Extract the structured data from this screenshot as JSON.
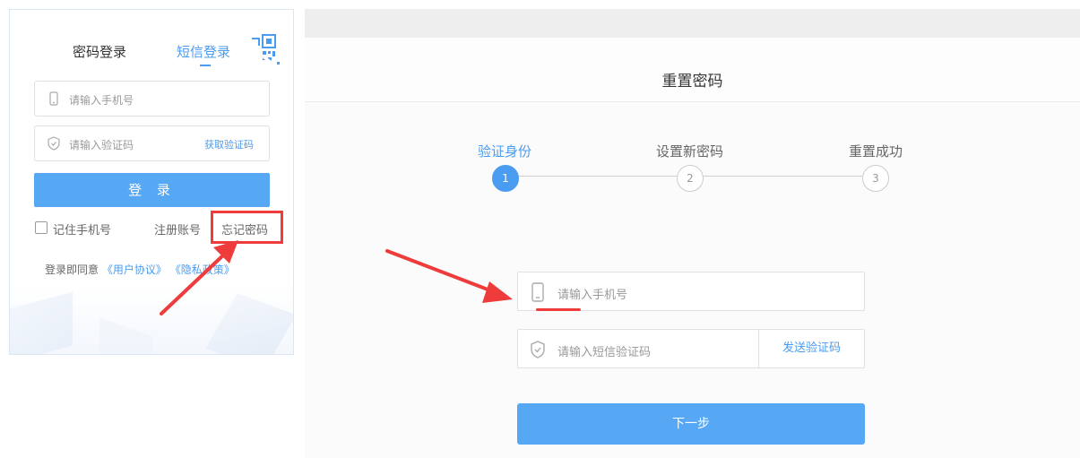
{
  "login": {
    "tabs": {
      "password": "密码登录",
      "sms": "短信登录"
    },
    "phone_placeholder": "请输入手机号",
    "code_placeholder": "请输入验证码",
    "get_code": "获取验证码",
    "login_button": "登 录",
    "remember": "记住手机号",
    "register": "注册账号",
    "forgot": "忘记密码",
    "agree_prefix": "登录即同意",
    "user_agreement": "《用户协议》",
    "privacy_policy": "《隐私政策》"
  },
  "reset": {
    "title": "重置密码",
    "steps": [
      {
        "label": "验证身份",
        "num": "1"
      },
      {
        "label": "设置新密码",
        "num": "2"
      },
      {
        "label": "重置成功",
        "num": "3"
      }
    ],
    "phone_placeholder": "请输入手机号",
    "sms_placeholder": "请输入短信验证码",
    "send_code": "发送验证码",
    "next_button": "下一步"
  },
  "colors": {
    "accent": "#4a9cf0",
    "button": "#56a8f5",
    "highlight": "#ee3b3b"
  },
  "icons": [
    "qr-code-icon",
    "phone-icon",
    "shield-icon"
  ]
}
